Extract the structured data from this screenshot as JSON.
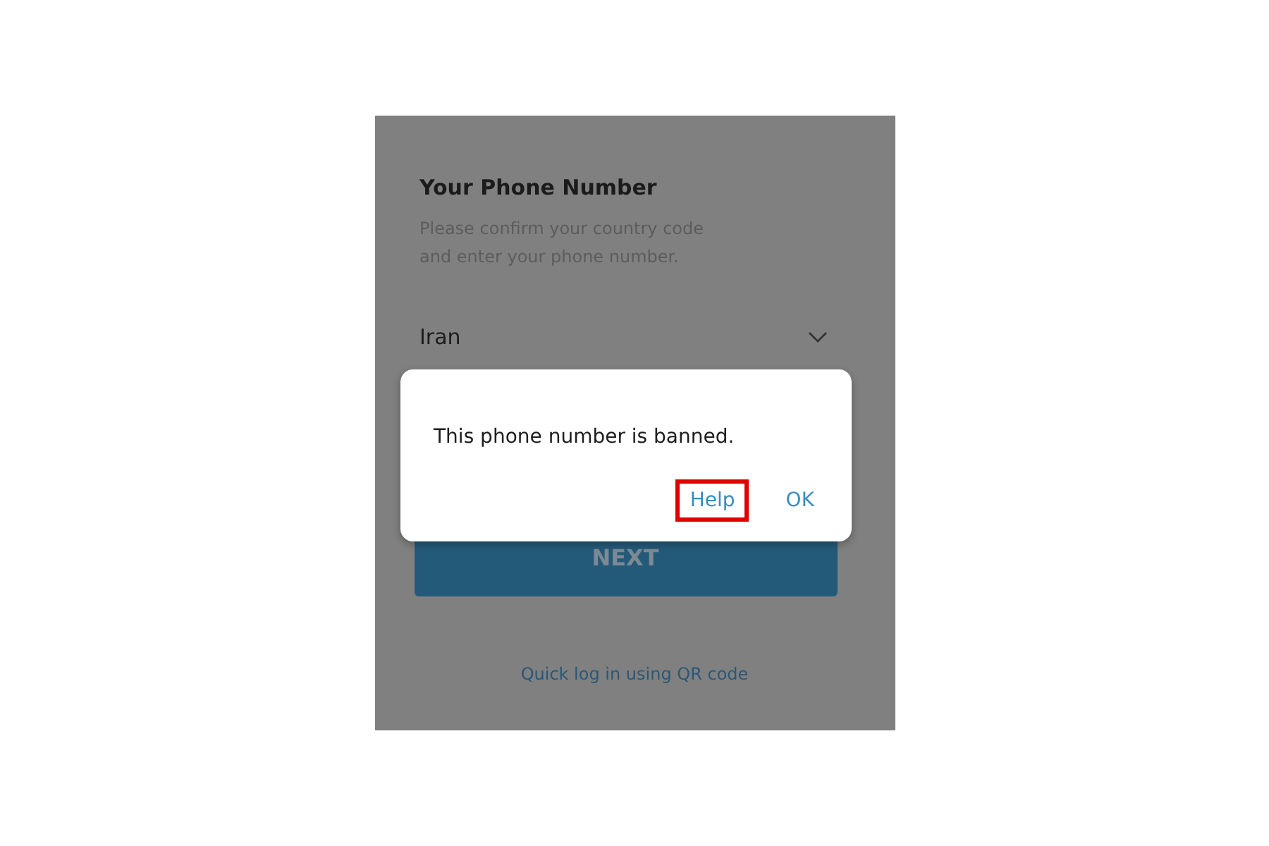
{
  "login": {
    "title": "Your Phone Number",
    "subtitle": "Please confirm your country code and enter your phone number.",
    "country": "Iran",
    "next_button": "NEXT",
    "qr_link": "Quick log in using QR code"
  },
  "dialog": {
    "message": "This phone number is banned.",
    "buttons": [
      {
        "label": "Help",
        "highlighted": true
      },
      {
        "label": "OK",
        "highlighted": false
      }
    ]
  }
}
